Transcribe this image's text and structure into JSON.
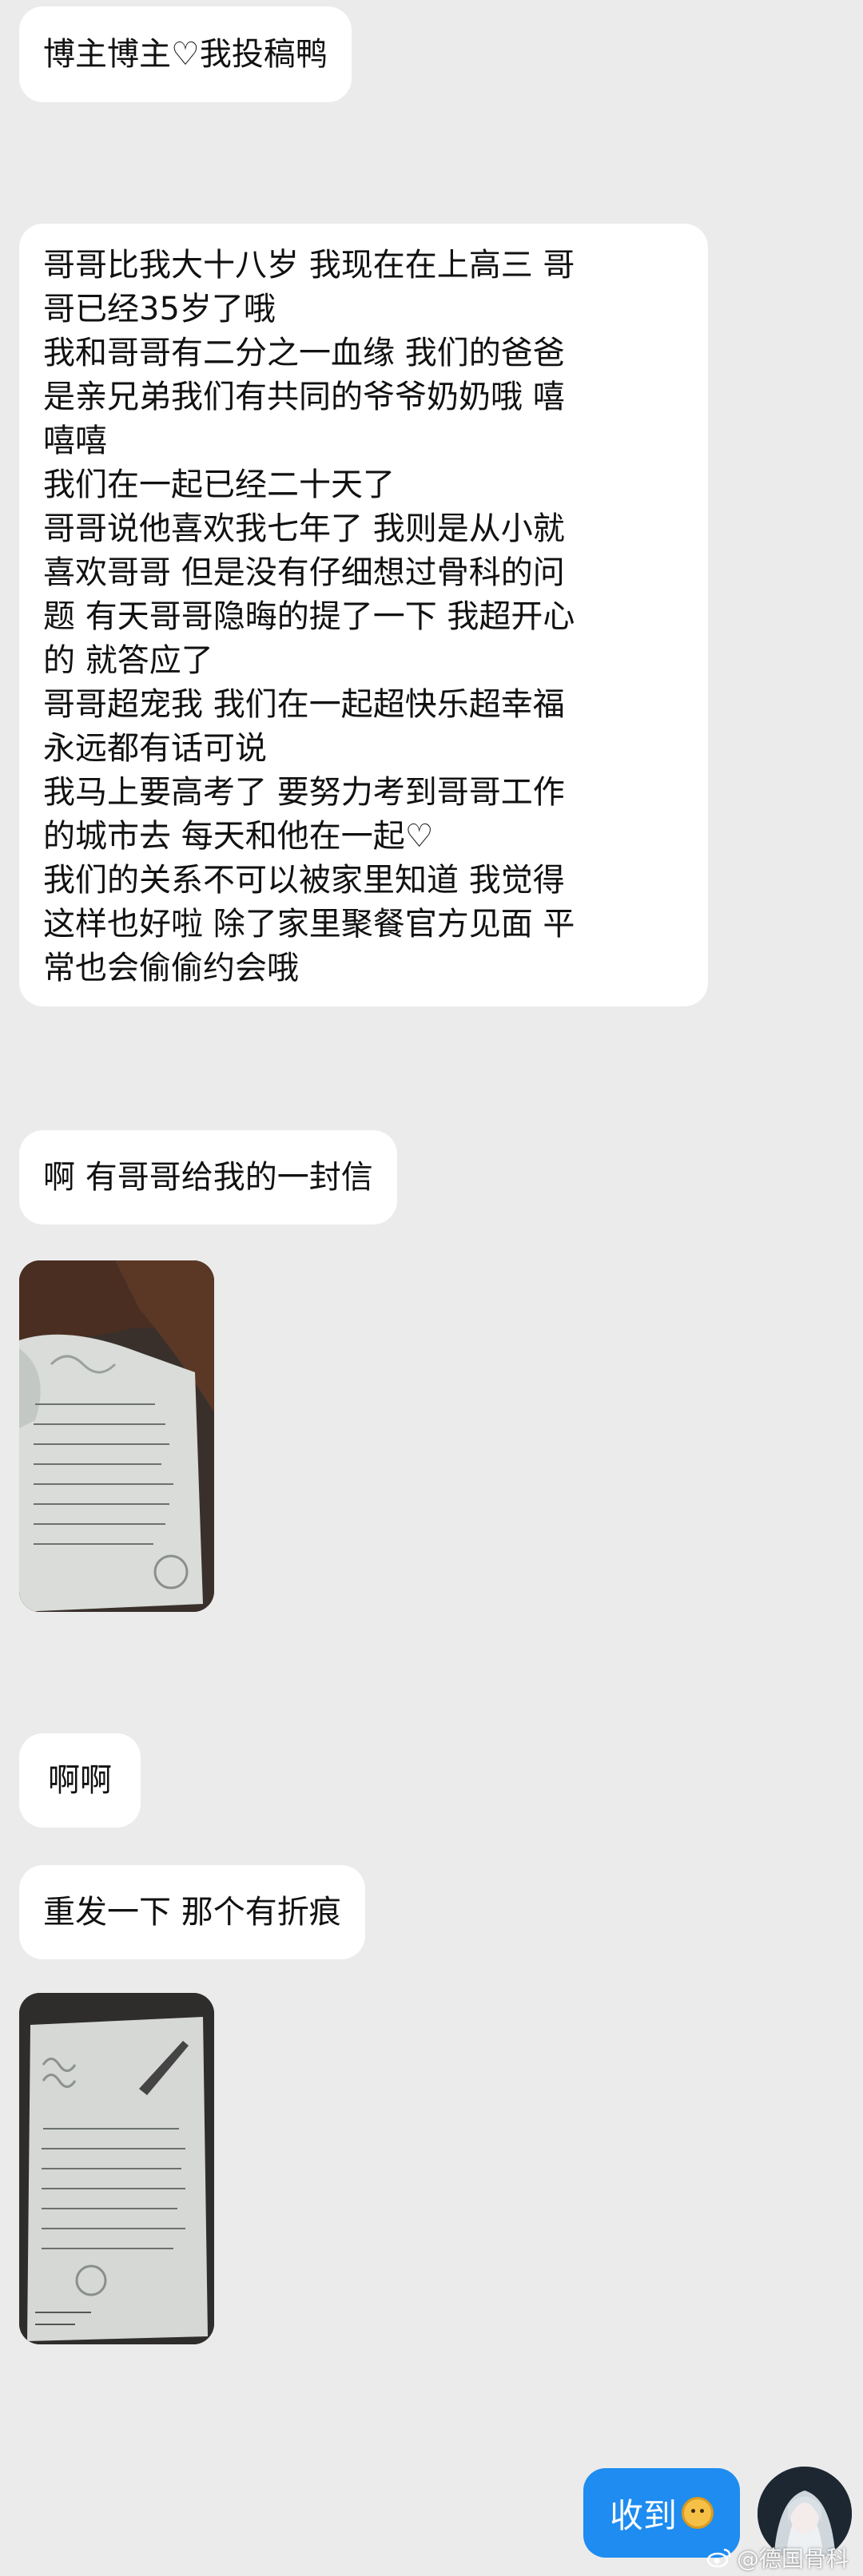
{
  "messages": {
    "m1": "博主博主♡我投稿鸭",
    "m2_lines": [
      "哥哥比我大十八岁 我现在在上高三 哥",
      "哥已经35岁了哦",
      "我和哥哥有二分之一血缘 我们的爸爸",
      "是亲兄弟我们有共同的爷爷奶奶哦 嘻",
      "嘻嘻",
      "我们在一起已经二十天了",
      "哥哥说他喜欢我七年了 我则是从小就",
      "喜欢哥哥 但是没有仔细想过骨科的问",
      "题 有天哥哥隐晦的提了一下 我超开心",
      "的 就答应了",
      "哥哥超宠我 我们在一起超快乐超幸福",
      "永远都有话可说",
      "我马上要高考了 要努力考到哥哥工作",
      "的城市去 每天和他在一起♡",
      "我们的关系不可以被家里知道 我觉得",
      "这样也好啦 除了家里聚餐官方见面 平",
      "常也会偷偷约会哦"
    ],
    "m3": "啊 有哥哥给我的一封信",
    "m4": "啊啊",
    "m5": "重发一下 那个有折痕",
    "outgoing": "收到"
  },
  "watermark": "@德国骨科",
  "icons": {
    "emoji": "smiling-face-emoji-icon",
    "watermark_logo": "weibo-logo-icon"
  },
  "colors": {
    "background": "#ebebeb",
    "bubble_in": "#ffffff",
    "bubble_out": "#1e8cf0"
  }
}
